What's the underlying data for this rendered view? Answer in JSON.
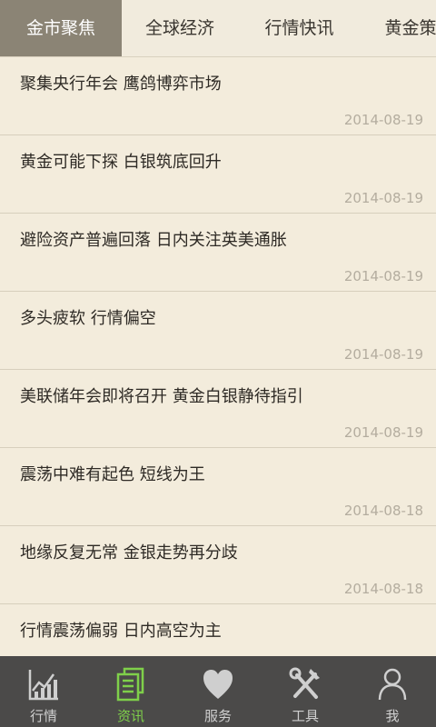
{
  "tabs": [
    {
      "label": "金市聚焦",
      "active": true
    },
    {
      "label": "全球经济",
      "active": false
    },
    {
      "label": "行情快讯",
      "active": false
    },
    {
      "label": "黄金策",
      "active": false
    }
  ],
  "articles": [
    {
      "title": "聚集央行年会 鹰鸽博弈市场",
      "date": "2014-08-19"
    },
    {
      "title": "黄金可能下探 白银筑底回升",
      "date": "2014-08-19"
    },
    {
      "title": "避险资产普遍回落 日内关注英美通胀",
      "date": "2014-08-19"
    },
    {
      "title": "多头疲软 行情偏空",
      "date": "2014-08-19"
    },
    {
      "title": "美联储年会即将召开 黄金白银静待指引",
      "date": "2014-08-19"
    },
    {
      "title": "震荡中难有起色 短线为王",
      "date": "2014-08-18"
    },
    {
      "title": "地缘反复无常 金银走势再分歧",
      "date": "2014-08-18"
    },
    {
      "title": "行情震荡偏弱 日内高空为主",
      "date": ""
    }
  ],
  "bottom_nav": [
    {
      "label": "行情",
      "icon": "chart-icon",
      "active": false
    },
    {
      "label": "资讯",
      "icon": "documents-icon",
      "active": true
    },
    {
      "label": "服务",
      "icon": "heart-icon",
      "active": false
    },
    {
      "label": "工具",
      "icon": "tools-icon",
      "active": false
    },
    {
      "label": "我",
      "icon": "user-icon",
      "active": false
    }
  ],
  "colors": {
    "active_tab_bg": "#8b8475",
    "bottom_bar_bg": "#4b4a49",
    "active_nav": "#7fd04a",
    "page_bg": "#f3ecdc"
  }
}
